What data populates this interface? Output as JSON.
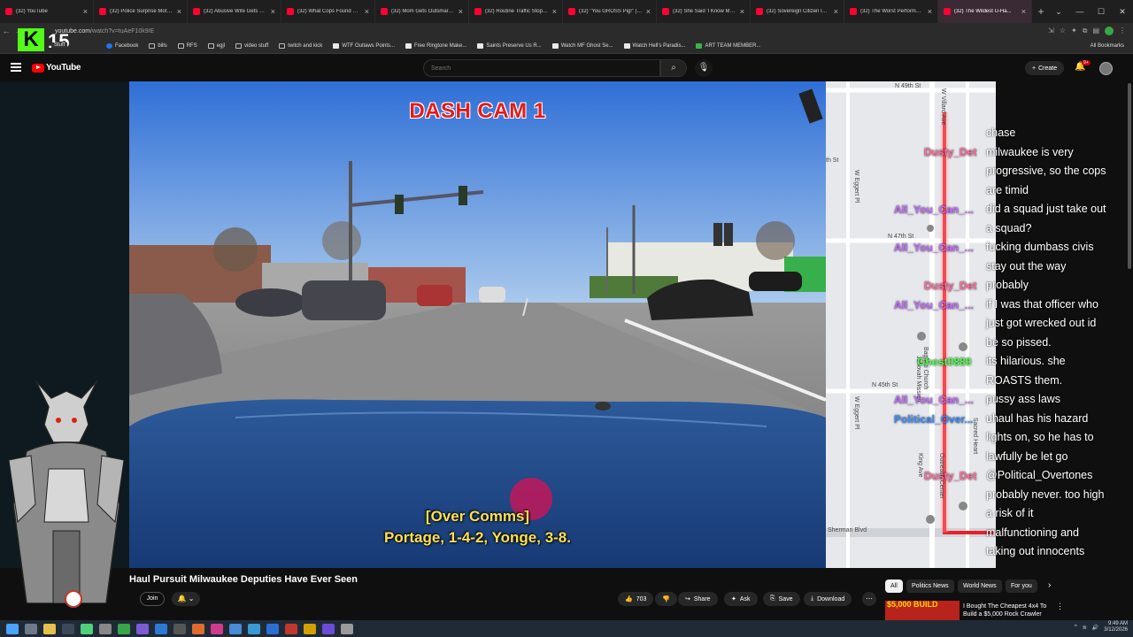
{
  "browser": {
    "tabs": [
      {
        "label": "(32) YouTube",
        "active": false
      },
      {
        "label": "(32) Police Surprise Mothe...",
        "active": false
      },
      {
        "label": "(32) Abusive Wife Gets Hu...",
        "active": false
      },
      {
        "label": "(32) What Cops Found On...",
        "active": false
      },
      {
        "label": "(32) Mom Gets Outsmarte...",
        "active": false
      },
      {
        "label": "(32) Routine Traffic Stop Tu...",
        "active": false
      },
      {
        "label": "(32) \"You GROSS Pig!\" | En...",
        "active": false
      },
      {
        "label": "(32) She Said 'I Know My R...",
        "active": false
      },
      {
        "label": "(32) Sovereign Citizen INS...",
        "active": false
      },
      {
        "label": "(32) The Worst Performan...",
        "active": false
      },
      {
        "label": "(32) The Wildest U-Ha...",
        "active": true
      }
    ],
    "new_tab": "+",
    "url_host": "youtube.com",
    "url_path": "/watch?v=tuAeF10k9IE",
    "bookmarks": [
      {
        "label": "Facebook",
        "icon": "facebook-icon"
      },
      {
        "label": "bills",
        "icon": "folder-icon"
      },
      {
        "label": "RFS",
        "icon": "folder-icon"
      },
      {
        "label": "egjl",
        "icon": "folder-icon"
      },
      {
        "label": "video stuff",
        "icon": "folder-icon"
      },
      {
        "label": "twitch and kick",
        "icon": "folder-icon"
      },
      {
        "label": "WTF Outlaws Points...",
        "icon": "link-icon"
      },
      {
        "label": "Free Ringtone Make...",
        "icon": "link-icon"
      },
      {
        "label": "Saints Preserve Us R...",
        "icon": "link-icon"
      },
      {
        "label": "Watch MF Ghost Se...",
        "icon": "link-icon"
      },
      {
        "label": "Watch Hell's Paradis...",
        "icon": "link-icon"
      },
      {
        "label": "ART TEAM MEMBER...",
        "icon": "link-icon"
      }
    ],
    "all_bookmarks": "All Bookmarks"
  },
  "overlay": {
    "kick_logo": "K",
    "viewer_count": "15",
    "tag": "Stuff"
  },
  "youtube": {
    "logo_text": "YouTube",
    "search_placeholder": "Search",
    "create_label": "Create",
    "notif_count": "9+"
  },
  "video": {
    "dash_label": "DASH CAM 1",
    "subtitle_line1": "[Over Comms]",
    "subtitle_line2": "Portage, 1-4-2, Yonge, 3-8."
  },
  "map": {
    "streets": [
      "N 49th St",
      "W Villard Ave",
      "th St",
      "W Eggert Pl",
      "N 47th St",
      "N 45th St",
      "W Eggert Pl",
      "Sherman Blvd",
      "Bagheti Church",
      "Jehovah Mission",
      "King Ave",
      "Sacred Heart",
      "Outreach Center"
    ]
  },
  "chat": {
    "messages": [
      "chase",
      "milwaukee is very",
      "progressive, so the cops",
      "are timid",
      "did a squad just take out",
      "a squad?",
      "fucking dumbass civis",
      "stay out the way",
      "probably",
      "if I was that officer who",
      "just got wrecked out id",
      "be so pissed.",
      "its hilarious. she",
      "ROASTS them.",
      "pussy ass laws",
      "uhaul has his hazard",
      "lights on, so he has to",
      "lawfully be let go",
      "@Political_Overtones",
      "probably never. too high",
      "a risk of it",
      "malfunctioning and",
      "taking out innocents"
    ],
    "users": [
      {
        "name": "Dusty_Det",
        "color": "#ff6b9d"
      },
      {
        "name": "All_You_Can_...",
        "color": "#c36bff"
      },
      {
        "name": "All_You_Can_...",
        "color": "#c36bff"
      },
      {
        "name": "Dusty_Det",
        "color": "#ff6b9d"
      },
      {
        "name": "All_You_Can_...",
        "color": "#c36bff"
      },
      {
        "name": "Ghost0889",
        "color": "#4cff4c"
      },
      {
        "name": "All_You_Can_...",
        "color": "#c36bff"
      },
      {
        "name": "Political_Over...",
        "color": "#3d8bff"
      },
      {
        "name": "Dusty_Det",
        "color": "#ff6b9d"
      }
    ]
  },
  "below": {
    "title": "Haul Pursuit Milwaukee Deputies Have Ever Seen",
    "join_label": "Join",
    "like_count": "703",
    "share_label": "Share",
    "ask_label": "Ask",
    "save_label": "Save",
    "download_label": "Download",
    "chips": [
      "All",
      "Politics News",
      "World News",
      "For you"
    ],
    "rec_thumb_text": "$5,000 BUILD",
    "rec_title": "I Bought The Cheapest 4x4 To Build a $5,000 Rock Crawler"
  },
  "taskbar": {
    "time": "9:49 AM",
    "date": "3/12/2026"
  },
  "colors": {
    "youtube_red": "#ff0000",
    "kick_green": "#53fc18",
    "subtitle_yellow": "#ffe14d",
    "dash_red": "#e51a1a",
    "route_red": "#e8202a"
  }
}
